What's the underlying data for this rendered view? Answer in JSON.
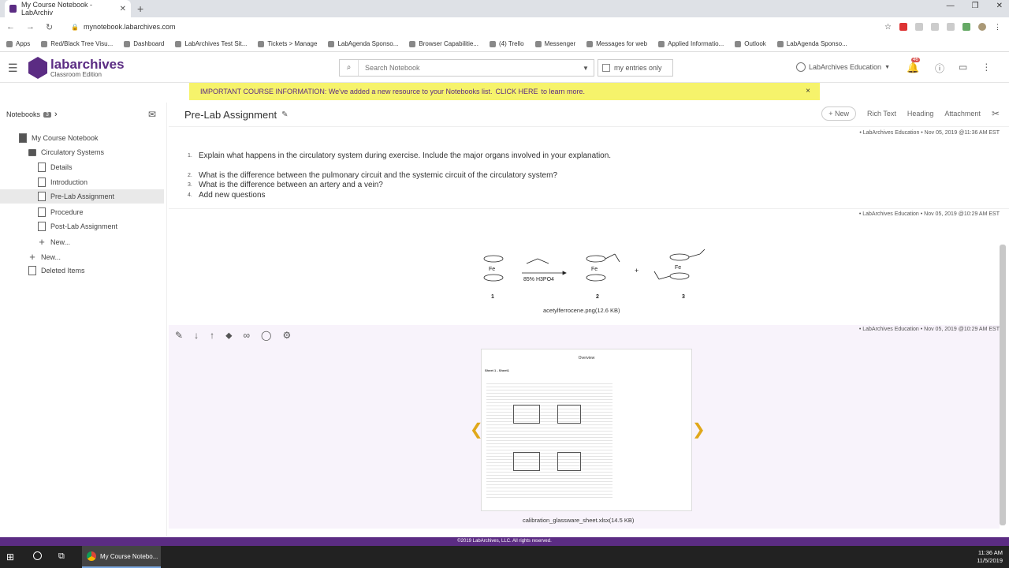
{
  "browser": {
    "tab_title": "My Course Notebook - LabArchiv",
    "url": "mynotebook.labarchives.com",
    "bookmarks": [
      "Apps",
      "Red/Black Tree Visu...",
      "Dashboard",
      "LabArchives Test Sit...",
      "Tickets > Manage",
      "LabAgenda Sponso...",
      "Browser Capabilitie...",
      "(4) Trello",
      "Messenger",
      "Messages for web",
      "Applied Informatio...",
      "Outlook",
      "LabAgenda Sponso..."
    ]
  },
  "header": {
    "logo_text": "labarchives",
    "logo_sub": "Classroom Edition",
    "search_placeholder": "Search Notebook",
    "my_entries_label": "my entries only",
    "user_name": "LabArchives Education",
    "notif_count": "46"
  },
  "banner": {
    "text": "IMPORTANT COURSE INFORMATION: We've added a new resource to your Notebooks list.",
    "link_text": "CLICK HERE",
    "suffix": "to learn more.",
    "close": "×"
  },
  "sidebar": {
    "notebooks_label": "Notebooks",
    "notebooks_count": "3",
    "inbox_badge": "1",
    "items": [
      {
        "label": "My Course Notebook"
      },
      {
        "label": "Circulatory Systems"
      },
      {
        "label": "Details"
      },
      {
        "label": "Introduction"
      },
      {
        "label": "Pre-Lab Assignment"
      },
      {
        "label": "Procedure"
      },
      {
        "label": "Post-Lab Assignment"
      },
      {
        "label": "New..."
      },
      {
        "label": "New..."
      },
      {
        "label": "Deleted Items"
      }
    ]
  },
  "page": {
    "title": "Pre-Lab Assignment",
    "toolbar": {
      "new": "New",
      "rich_text": "Rich Text",
      "heading": "Heading",
      "attachment": "Attachment"
    }
  },
  "entries": [
    {
      "meta": "• LabArchives Education • Nov 05, 2019 @11:36 AM EST",
      "questions": [
        {
          "n": "1.",
          "text": "Explain what happens in the circulatory system during exercise. Include the major organs involved in your explanation."
        },
        {
          "n": "2.",
          "text": "What is the difference between the pulmonary circuit and the systemic circuit of the circulatory system?"
        },
        {
          "n": "3.",
          "text": "What is the difference between an artery and a vein?"
        },
        {
          "n": "4.",
          "text": "Add new questions"
        }
      ]
    },
    {
      "meta": "• LabArchives Education • Nov 05, 2019 @10:29 AM EST",
      "caption": "acetylferrocene.png(12.6 KB)",
      "reagent": "85% H3PO4",
      "labels": [
        "1",
        "2",
        "3"
      ],
      "fe": "Fe"
    },
    {
      "meta": "• LabArchives Education • Nov 05, 2019 @10:29 AM EST",
      "caption": "calibration_glassware_sheet.xlsx(14.5 KB)",
      "sheet_title": "Overview",
      "sheet_tab": "Sheet 1 - Sheet1"
    }
  ],
  "footer": "©2019 LabArchives, LLC. All rights reserved.",
  "taskbar": {
    "app": "My Course Notebo...",
    "time": "11:36 AM",
    "date": "11/5/2019"
  }
}
